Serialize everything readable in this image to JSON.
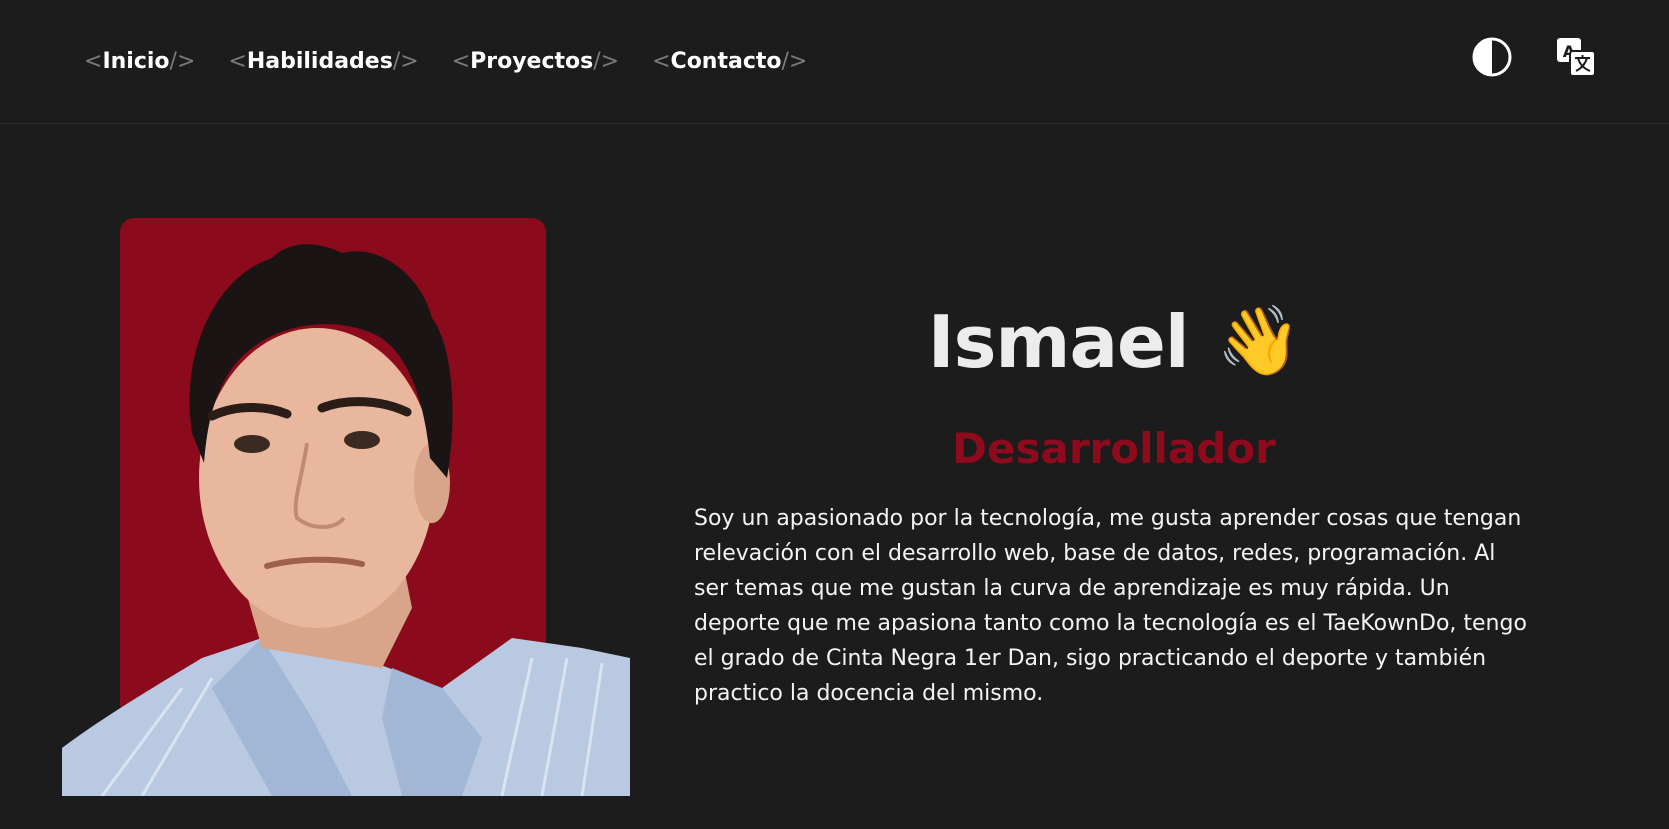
{
  "nav": {
    "open_bracket": "<",
    "close_bracket": "/>",
    "items": [
      {
        "label": "Inicio"
      },
      {
        "label": "Habilidades"
      },
      {
        "label": "Proyectos"
      },
      {
        "label": "Contacto"
      }
    ]
  },
  "tools": {
    "theme_icon": "contrast-icon",
    "language_icon": "translate-icon"
  },
  "hero": {
    "name": "Ismael",
    "wave_emoji": "👋",
    "role": "Desarrollador",
    "bio": "Soy un apasionado por la tecnología, me gusta aprender cosas que tengan relevación con el desarrollo web, base de datos, redes, programación. Al ser temas que me gustan la curva de aprendizaje es muy rápida. Un deporte que me apasiona tanto como la tecnología es el TaeKownDo, tengo el grado de Cinta Negra 1er Dan, sigo practicando el deporte y también practico la docencia del mismo."
  },
  "colors": {
    "background": "#1c1c1c",
    "accent": "#8e0a1d",
    "text": "#f2f2f2",
    "bracket": "#7b7b7b"
  }
}
